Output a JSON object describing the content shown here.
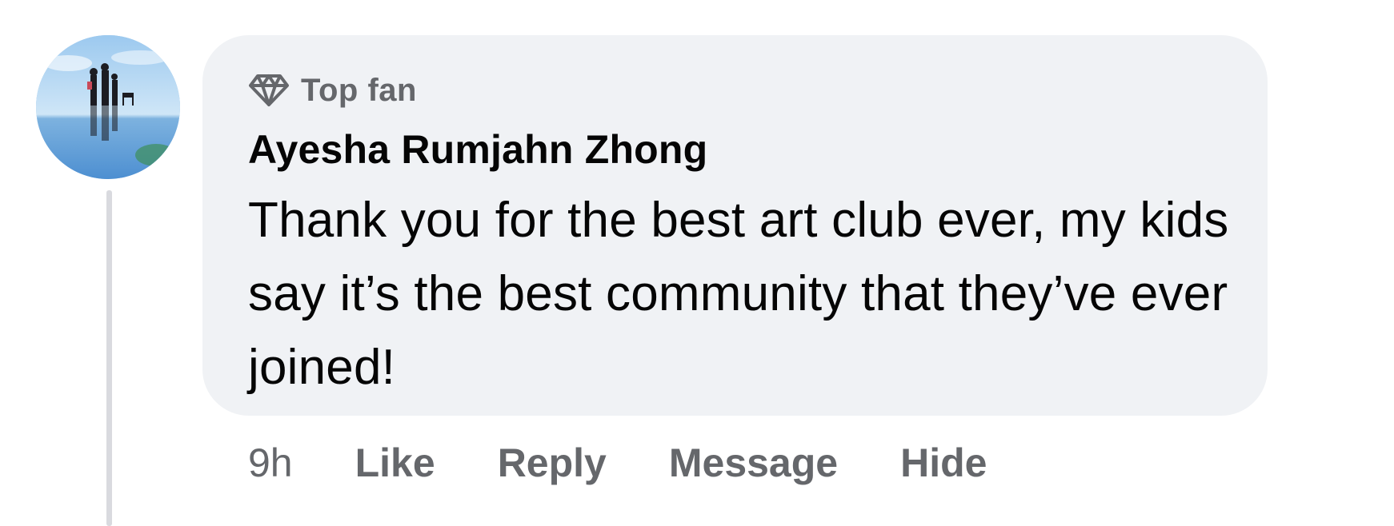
{
  "comment": {
    "badge": {
      "icon": "diamond-icon",
      "label": "Top fan"
    },
    "author": "Ayesha Rumjahn Zhong",
    "text": "Thank you for the best art club ever, my kids say it’s the best community that they’ve ever joined!",
    "timestamp": "9h",
    "actions": {
      "like": "Like",
      "reply": "Reply",
      "message": "Message",
      "hide": "Hide"
    }
  },
  "colors": {
    "bubble": "#f0f2f5",
    "text_primary": "#050505",
    "text_secondary": "#65676b",
    "thread_line": "#d9dadf"
  }
}
